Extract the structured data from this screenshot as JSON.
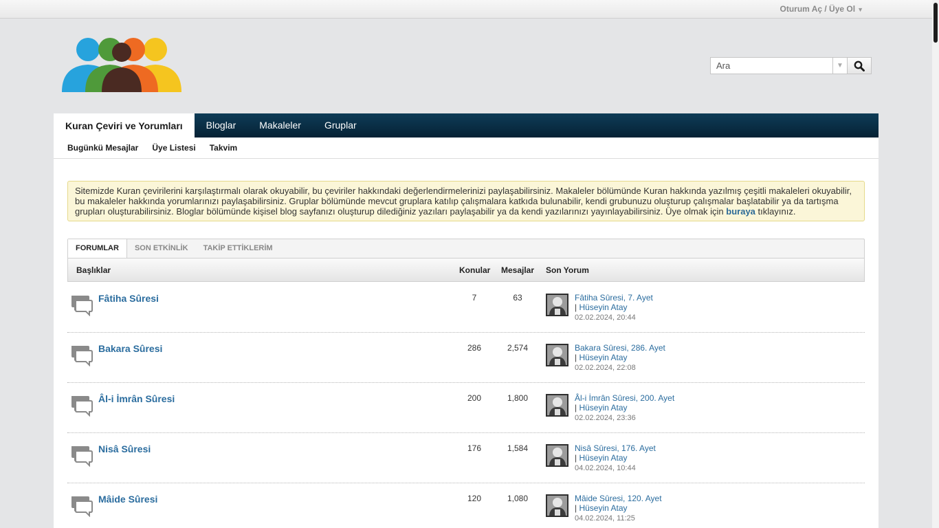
{
  "topbar": {
    "login_label": "Oturum Aç / Üye Ol"
  },
  "search": {
    "placeholder": "Ara",
    "value": "Ara"
  },
  "nav": {
    "tabs": [
      {
        "label": "Kuran Çeviri ve Yorumları",
        "active": true
      },
      {
        "label": "Bloglar"
      },
      {
        "label": "Makaleler"
      },
      {
        "label": "Gruplar"
      }
    ]
  },
  "subnav": {
    "items": [
      "Bugünkü Mesajlar",
      "Üye Listesi",
      "Takvim"
    ]
  },
  "notice": {
    "text": "Sitemizde Kuran çevirilerini karşılaştırmalı olarak okuyabilir, bu çeviriler hakkındaki değerlendirmelerinizi paylaşabilirsiniz. Makaleler bölümünde Kuran hakkında yazılmış çeşitli makaleleri okuyabilir, bu makaleler hakkında yorumlarınızı paylaşabilirsiniz. Gruplar bölümünde mevcut gruplara katılıp çalışmalara katkıda bulunabilir, kendi grubunuzu oluşturup çalışmalar başlatabilir ya da tartışma grupları oluşturabilirsiniz. Bloglar bölümünde kişisel blog sayfanızı oluşturup dilediğiniz yazıları paylaşabilir ya da kendi yazılarınızı yayınlayabilirsiniz. Üye olmak için ",
    "link": "buraya",
    "suffix": " tıklayınız."
  },
  "tabs": [
    "FORUMLAR",
    "SON ETKİNLİK",
    "TAKİP ETTİKLERİM"
  ],
  "table": {
    "headers": {
      "title": "Başlıklar",
      "topics": "Konular",
      "posts": "Mesajlar",
      "last": "Son Yorum"
    },
    "rows": [
      {
        "title": "Fâtiha Sûresi",
        "topics": "7",
        "posts": "63",
        "last_title": "Fâtiha Sûresi, 7. Ayet",
        "last_user": "Hüseyin Atay",
        "last_date": "02.02.2024, 20:44"
      },
      {
        "title": "Bakara Sûresi",
        "topics": "286",
        "posts": "2,574",
        "last_title": "Bakara Sûresi, 286. Ayet",
        "last_user": "Hüseyin Atay",
        "last_date": "02.02.2024, 22:08"
      },
      {
        "title": "Âl-i İmrân Sûresi",
        "topics": "200",
        "posts": "1,800",
        "last_title": "Âl-i İmrân Sûresi, 200. Ayet",
        "last_user": "Hüseyin Atay",
        "last_date": "02.02.2024, 23:36"
      },
      {
        "title": "Nisâ Sûresi",
        "topics": "176",
        "posts": "1,584",
        "last_title": "Nisâ Sûresi, 176. Ayet",
        "last_user": "Hüseyin Atay",
        "last_date": "04.02.2024, 10:44"
      },
      {
        "title": "Mâide Sûresi",
        "topics": "120",
        "posts": "1,080",
        "last_title": "Mâide Sûresi, 120. Ayet",
        "last_user": "Hüseyin Atay",
        "last_date": "04.02.2024, 11:25"
      }
    ]
  },
  "icons": {
    "search": "magnifier-icon",
    "forum": "speech-bubbles-icon",
    "logo": "people-logo"
  }
}
